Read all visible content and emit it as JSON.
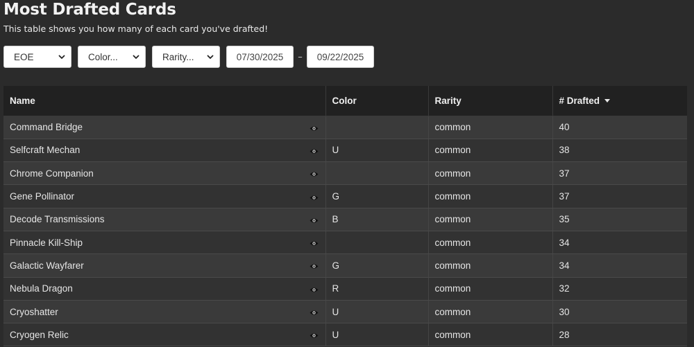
{
  "header": {
    "title": "Most Drafted Cards",
    "subtitle": "This table shows you how many of each card you've drafted!"
  },
  "filters": {
    "set_value": "EOE",
    "color_value": "Color...",
    "rarity_value": "Rarity...",
    "start_date": "07/30/2025",
    "date_separator": "–",
    "end_date": "09/22/2025"
  },
  "table": {
    "columns": [
      "Name",
      "Color",
      "Rarity",
      "# Drafted"
    ],
    "sort_column": "# Drafted",
    "sort_direction": "desc",
    "rows": [
      {
        "name": "Command Bridge",
        "color": "",
        "rarity": "common",
        "drafted": "40"
      },
      {
        "name": "Selfcraft Mechan",
        "color": "U",
        "rarity": "common",
        "drafted": "38"
      },
      {
        "name": "Chrome Companion",
        "color": "",
        "rarity": "common",
        "drafted": "37"
      },
      {
        "name": "Gene Pollinator",
        "color": "G",
        "rarity": "common",
        "drafted": "37"
      },
      {
        "name": "Decode Transmissions",
        "color": "B",
        "rarity": "common",
        "drafted": "35"
      },
      {
        "name": "Pinnacle Kill-Ship",
        "color": "",
        "rarity": "common",
        "drafted": "34"
      },
      {
        "name": "Galactic Wayfarer",
        "color": "G",
        "rarity": "common",
        "drafted": "34"
      },
      {
        "name": "Nebula Dragon",
        "color": "R",
        "rarity": "common",
        "drafted": "32"
      },
      {
        "name": "Cryoshatter",
        "color": "U",
        "rarity": "common",
        "drafted": "30"
      },
      {
        "name": "Cryogen Relic",
        "color": "U",
        "rarity": "common",
        "drafted": "28"
      }
    ]
  },
  "icons": {
    "row_action": "eye-icon",
    "select_caret": "chevron-down-icon",
    "sort_indicator": "sort-desc-caret-icon"
  },
  "colors": {
    "page_background": "#2b2b2b",
    "header_row": "#212121",
    "row_odd": "#3a3a3a",
    "row_even": "#323232"
  }
}
